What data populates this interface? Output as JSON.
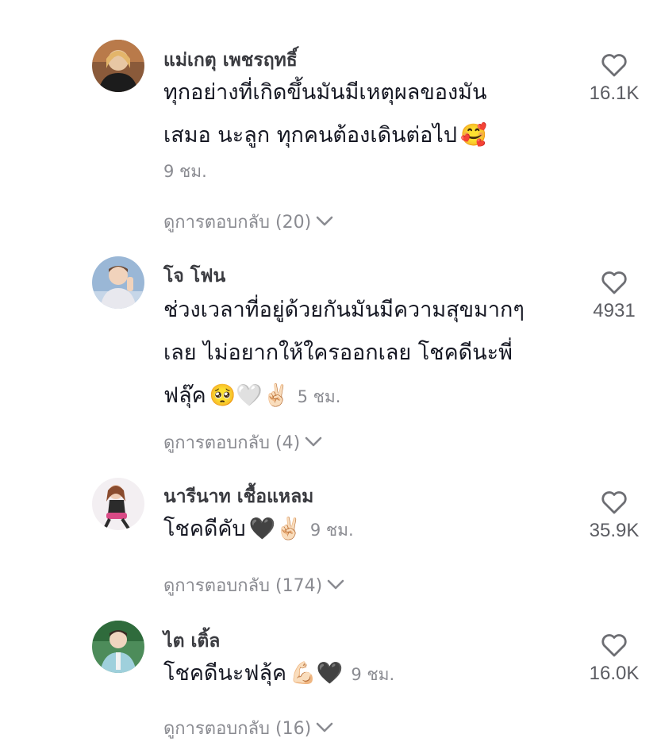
{
  "comments": [
    {
      "username": "แม่เกตุ เพชรฤทธิ์",
      "text_lines": [
        "ทุกอย่างที่เกิดขึ้นมันมีเหตุผลของมัน",
        "เสมอ นะลูก ทุกคนต้องเดินต่อไป"
      ],
      "emoji": "🥰",
      "time": "9 ชม.",
      "replies": "ดูการตอบกลับ (20)",
      "likes": "16.1K",
      "avatar_colors": [
        "#8a5a3a",
        "#e7c7a4",
        "#1c1c1c"
      ]
    },
    {
      "username": "โจ โฟน",
      "text_lines": [
        "ช่วงเวลาที่อยู่ด้วยกันมันมีความสุขมากๆ",
        "เลย ไม่อยากให้ใครออกเลย โชคดีนะพี่",
        "ฟลุ๊ค"
      ],
      "emoji": "🥺🤍✌🏻",
      "time": "5 ชม.",
      "replies": "ดูการตอบกลับ (4)",
      "likes": "4931",
      "avatar_colors": [
        "#9ab7d6",
        "#f1d3bc",
        "#e8e8ee"
      ]
    },
    {
      "username": "นารีนาท เชื้อแหลม",
      "text_lines": [
        "โชคดีคับ"
      ],
      "emoji": "🖤✌🏻",
      "time": "9 ชม.",
      "replies": "ดูการตอบกลับ (174)",
      "likes": "35.9K",
      "avatar_colors": [
        "#f3eff2",
        "#d94a86",
        "#2b2b2b"
      ]
    },
    {
      "username": "ไต เติ้ล",
      "text_lines": [
        "โชคดีนะฟลุ้ค"
      ],
      "emoji": "💪🏻🖤",
      "time": "9 ชม.",
      "replies": "ดูการตอบกลับ (16)",
      "likes": "16.0K",
      "avatar_colors": [
        "#4d8c5a",
        "#9fd0dc",
        "#f0d5bf"
      ]
    }
  ]
}
